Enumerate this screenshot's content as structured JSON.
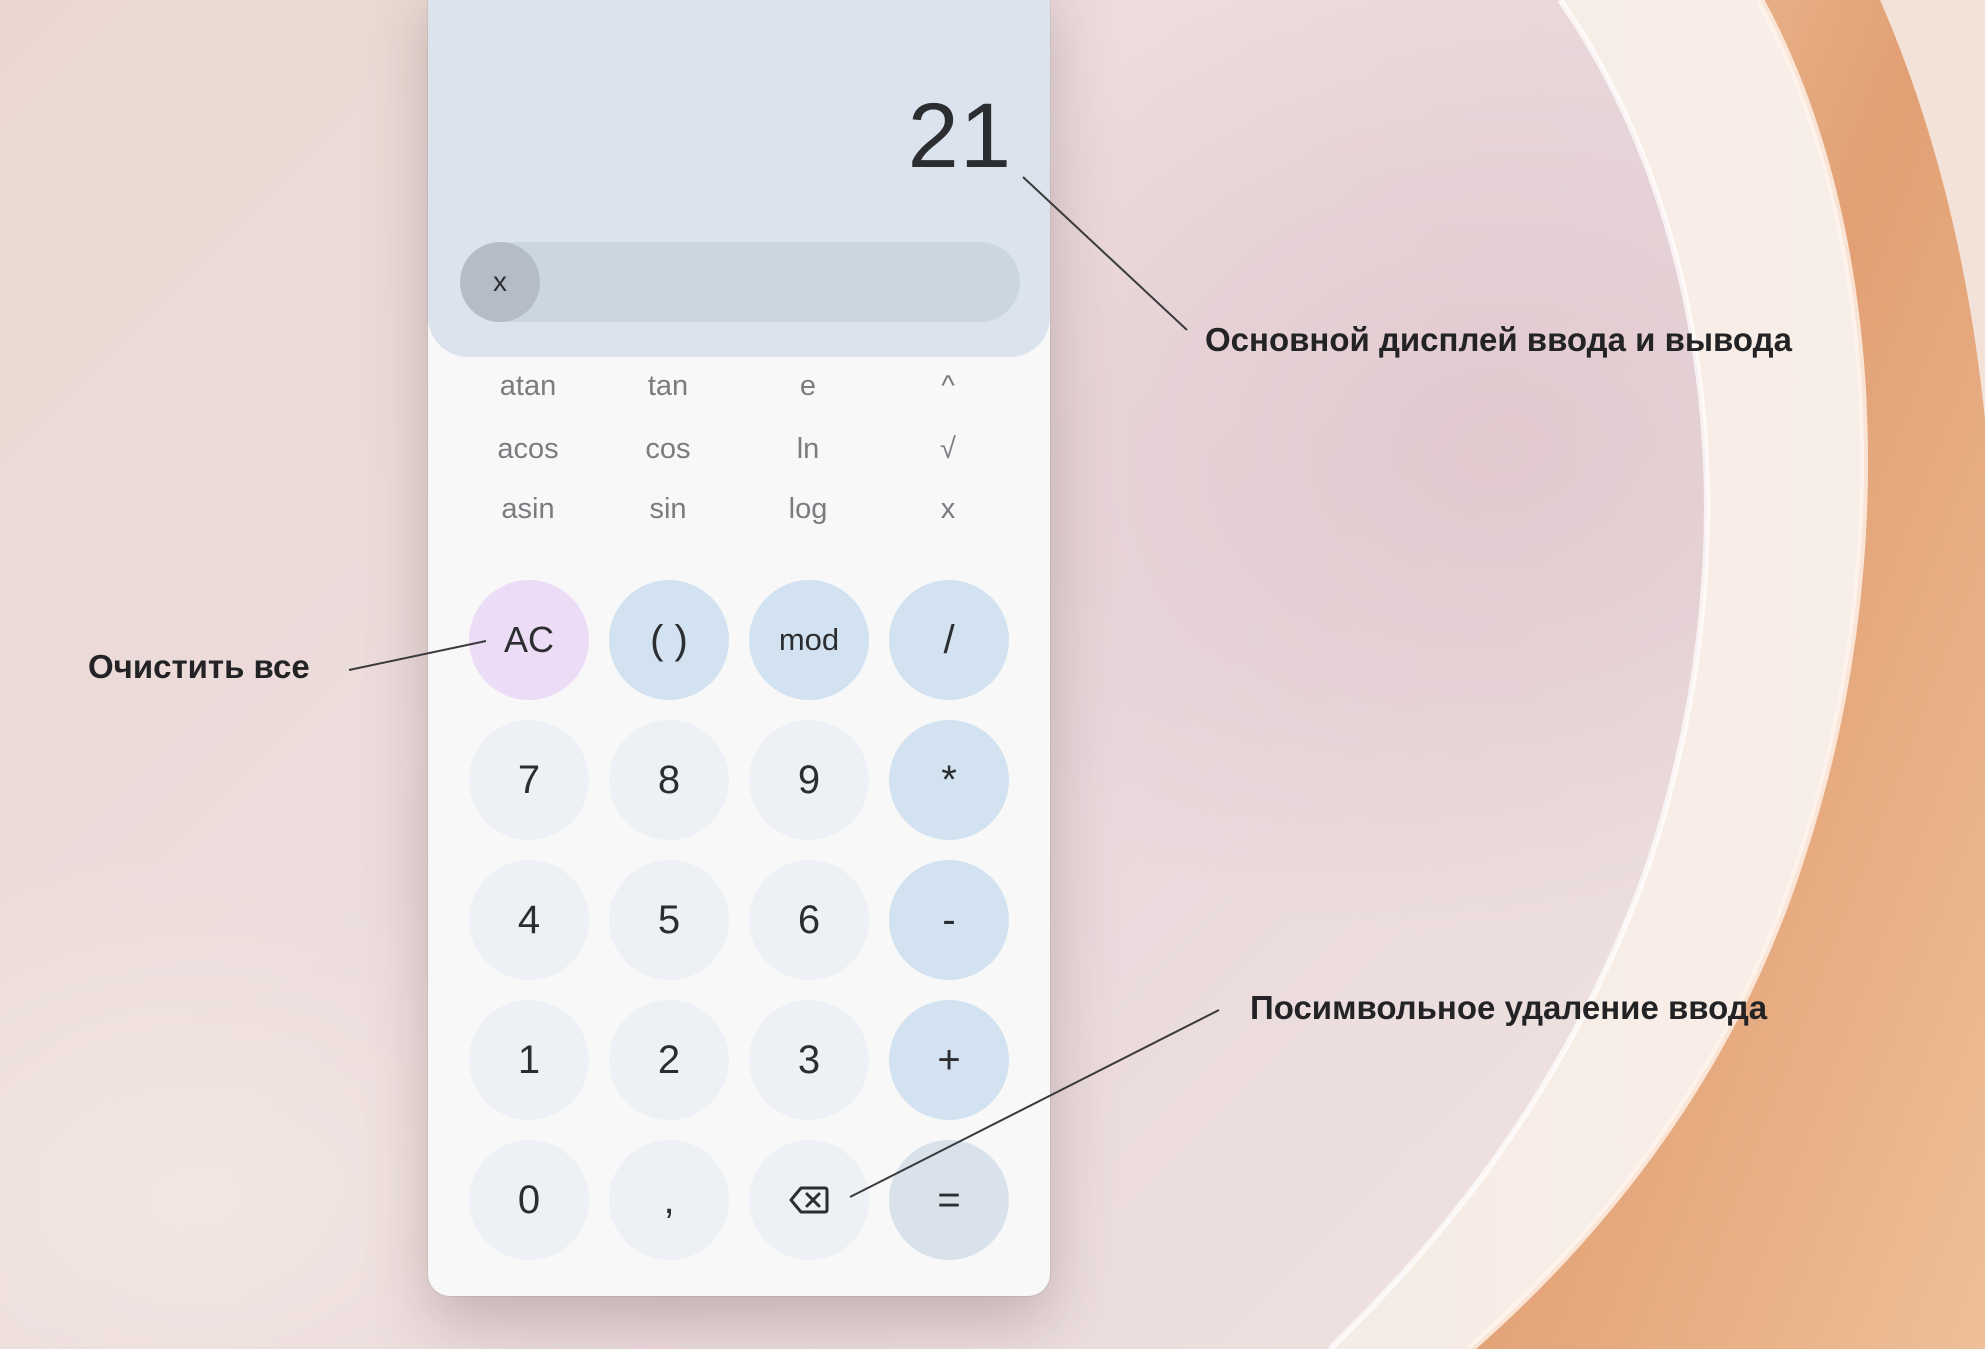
{
  "calculator": {
    "display_value": "21",
    "history_close_label": "x",
    "function_keys": [
      [
        "atan",
        "tan",
        "e",
        "^"
      ],
      [
        "acos",
        "cos",
        "ln",
        "√"
      ],
      [
        "asin",
        "sin",
        "log",
        "x"
      ]
    ],
    "keys": {
      "ac": "AC",
      "parens": "( )",
      "mod": "mod",
      "divide": "/",
      "seven": "7",
      "eight": "8",
      "nine": "9",
      "multiply": "*",
      "four": "4",
      "five": "5",
      "six": "6",
      "subtract": "-",
      "one": "1",
      "two": "2",
      "three": "3",
      "add": "+",
      "zero": "0",
      "comma": ",",
      "backspace_icon": "backspace-icon",
      "equals": "="
    },
    "colors": {
      "display_background": "#dbe4ee",
      "operator_key": "#d2e2f1",
      "clear_key": "#ecdcf6",
      "digit_key": "#edf0f5"
    }
  },
  "annotations": {
    "display": "Основной дисплей ввода и вывода",
    "clear_all": "Очистить все",
    "backspace": "Посимвольное удаление ввода"
  }
}
